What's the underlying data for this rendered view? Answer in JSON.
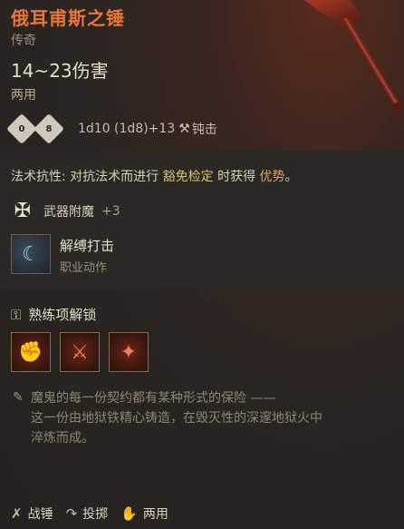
{
  "item": {
    "name": "俄耳甫斯之锤",
    "rarity": "传奇",
    "damage": "14~23伤害",
    "handedness": "两用",
    "dice": {
      "die1": "0",
      "die2": "8",
      "formula": "1d10 (1d8)+13",
      "damage_type": "钝击"
    }
  },
  "properties": {
    "spell_resistance": {
      "label": "法术抗性:",
      "text_before": " 对抗法术而进行 ",
      "save": "豁免检定",
      "text_mid": " 时获得 ",
      "advantage": "优势",
      "text_end": "。"
    },
    "enchant": {
      "label": "武器附魔",
      "value": "+3"
    },
    "skill": {
      "name": "解缚打击",
      "sub": "职业动作"
    }
  },
  "proficiency": {
    "title": "熟练项解锁"
  },
  "flavor": {
    "line1": "魔鬼的每一份契约都有某种形式的保险 ——",
    "line2": "这一份由地狱铁精心铸造，在毁灭性的深邃地狱火中",
    "line3": "淬炼而成。"
  },
  "tags": {
    "tag1": "战锤",
    "tag2": "投掷",
    "tag3": "两用"
  },
  "colors": {
    "title": "#e8753a",
    "highlight": "#d6c26d",
    "advantage": "#e3a063"
  }
}
